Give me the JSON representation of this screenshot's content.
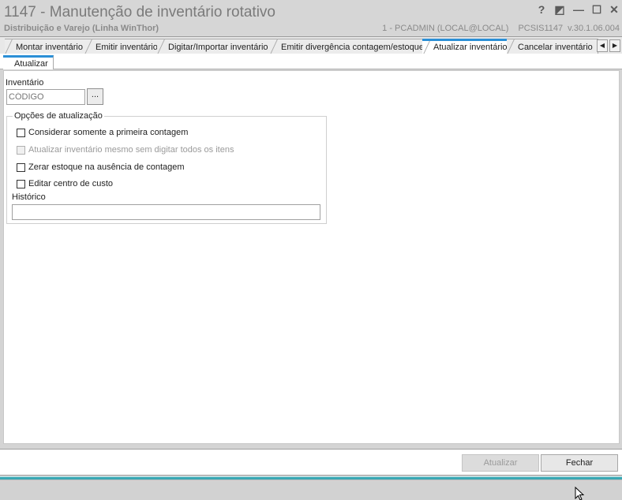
{
  "window": {
    "title": "1147 - Manutenção de inventário rotativo",
    "subtitle": "Distribuição e Varejo (Linha WinThor)",
    "session": "1 - PCADMIN (LOCAL@LOCAL)",
    "program": "PCSIS1147",
    "version": "v.30.1.06.004",
    "controls": [
      "help-icon",
      "restore-icon",
      "minimize-icon",
      "maximize-icon",
      "close-icon"
    ],
    "control_glyphs": {
      "help": "?",
      "restore": "◩",
      "minimize": "—",
      "maximize": "☐",
      "close": "✕"
    }
  },
  "tabs": [
    {
      "label": "Montar inventário",
      "active": false
    },
    {
      "label": "Emitir inventário",
      "active": false
    },
    {
      "label": "Digitar/Importar inventário",
      "active": false
    },
    {
      "label": "Emitir divergência contagem/estoque",
      "active": false
    },
    {
      "label": "Atualizar inventário",
      "active": true
    },
    {
      "label": "Cancelar inventário",
      "active": false
    }
  ],
  "tab_nav": {
    "prev": "◀",
    "next": "▶"
  },
  "subtabs": [
    {
      "label": "Atualizar",
      "active": true
    }
  ],
  "form": {
    "inventario_label": "Inventário",
    "codigo_placeholder": "CÓDIGO",
    "lookup_label": "...",
    "options_title": "Opções de atualização",
    "options": [
      {
        "label": "Considerar somente a primeira contagem",
        "checked": false,
        "enabled": true
      },
      {
        "label": "Atualizar inventário mesmo sem digitar todos os itens",
        "checked": false,
        "enabled": false
      },
      {
        "label": "Zerar estoque na ausência de contagem",
        "checked": false,
        "enabled": true
      },
      {
        "label": "Editar centro de custo",
        "checked": false,
        "enabled": true
      }
    ],
    "historico_label": "Histórico",
    "historico_value": ""
  },
  "footer": {
    "atualizar_label": "Atualizar",
    "atualizar_enabled": false,
    "fechar_label": "Fechar"
  },
  "colors": {
    "accent": "#2b8fd6",
    "status_teal": "#3aa7b3",
    "titlebar": "#d6d6d6"
  }
}
